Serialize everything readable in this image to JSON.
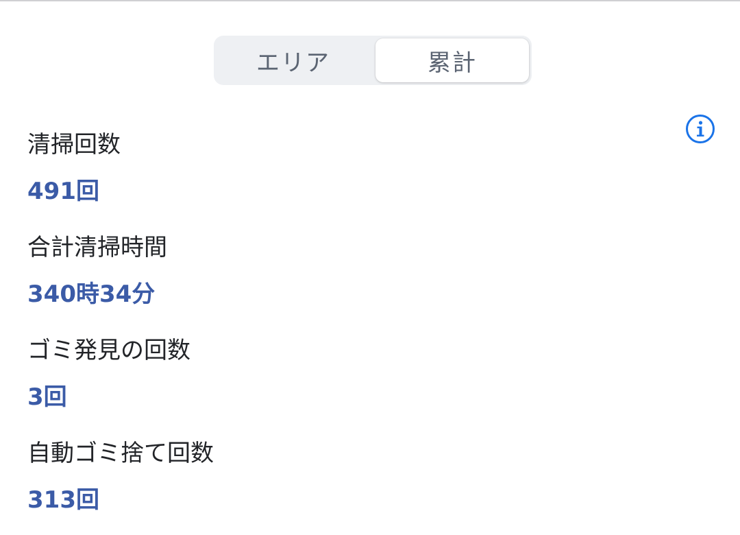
{
  "segmented_control": {
    "tabs": [
      {
        "label": "エリア",
        "selected": false
      },
      {
        "label": "累計",
        "selected": true
      }
    ]
  },
  "info": {
    "icon": "info-circle-icon",
    "color": "#1a73e8"
  },
  "stats": [
    {
      "label": "清掃回数",
      "value": "491回"
    },
    {
      "label": "合計清掃時間",
      "value": "340時34分"
    },
    {
      "label": "ゴミ発見の回数",
      "value": "3回"
    },
    {
      "label": "自動ゴミ捨て回数",
      "value": "313回"
    }
  ],
  "colors": {
    "value_text": "#3b5ba7",
    "label_text": "#222428",
    "segment_bg": "#eef0f3"
  }
}
